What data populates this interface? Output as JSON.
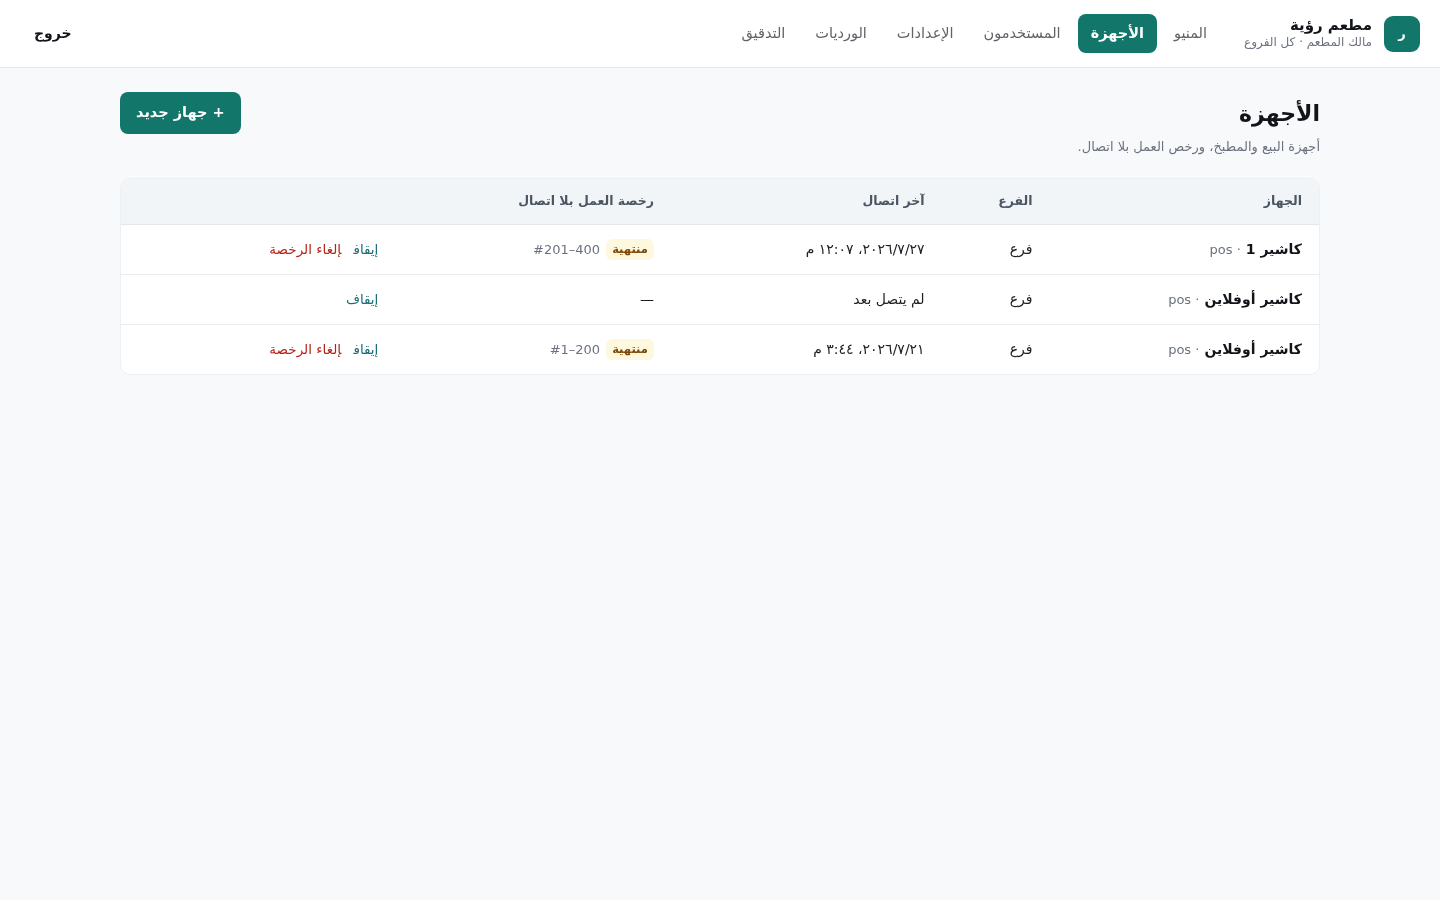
{
  "header": {
    "avatar": "ر",
    "brand": {
      "name": "مطعم رؤية",
      "subtitle": "مالك المطعم · كل الفروع"
    },
    "nav": [
      {
        "label": "المنيو",
        "selected": false
      },
      {
        "label": "الأجهزة",
        "selected": true
      },
      {
        "label": "المستخدمون",
        "selected": false
      },
      {
        "label": "الإعدادات",
        "selected": false
      },
      {
        "label": "الورديات",
        "selected": false
      },
      {
        "label": "التدقيق",
        "selected": false
      }
    ],
    "logout": "خروج"
  },
  "page": {
    "title": "الأجهزة",
    "subtitle": "أجهزة البيع والمطبخ، ورخص العمل بلا اتصال.",
    "new_button": "+ جهاز جديد"
  },
  "table": {
    "columns": [
      "الجهاز",
      "الفرع",
      "آخر اتصال",
      "رخصة العمل بلا اتصال"
    ],
    "rows": [
      {
        "device": {
          "name": "كاشير 1",
          "meta": "· pos"
        },
        "branch": "فرع",
        "last_seen": "٢٠٢٦/٧/٢٧، ١٢:٠٧ م",
        "license": {
          "kind": "expired",
          "badge": "منتهية",
          "text": "#201–400"
        },
        "actions": [
          {
            "label": "إيقاف",
            "kind": "neutral"
          },
          {
            "label": "إلغاء الرخصة",
            "kind": "danger"
          }
        ]
      },
      {
        "device": {
          "name": "كاشير أوفلاين",
          "meta": "· pos"
        },
        "branch": "فرع",
        "last_seen": "لم يتصل بعد",
        "license": {
          "kind": "none",
          "text": "—"
        },
        "actions": [
          {
            "label": "إيقاف",
            "kind": "neutral"
          }
        ]
      },
      {
        "device": {
          "name": "كاشير أوفلاين",
          "meta": "· pos"
        },
        "branch": "فرع",
        "last_seen": "٢٠٢٦/٧/٢١، ٣:٤٤ م",
        "license": {
          "kind": "expired",
          "badge": "منتهية",
          "text": "#1–200"
        },
        "actions": [
          {
            "label": "إيقاف",
            "kind": "neutral"
          },
          {
            "label": "إلغاء الرخصة",
            "kind": "danger"
          }
        ]
      }
    ]
  }
}
